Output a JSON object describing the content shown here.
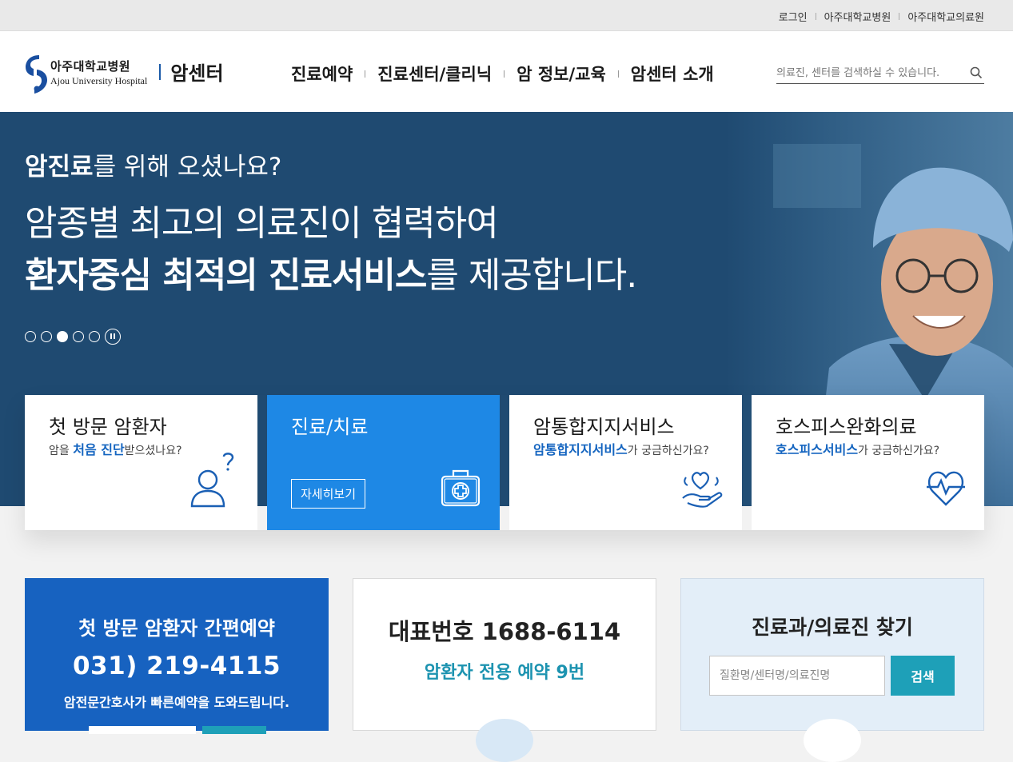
{
  "util_links": [
    "로그인",
    "아주대학교병원",
    "아주대학교의료원"
  ],
  "logo": {
    "kr": "아주대학교병원",
    "en": "Ajou University Hospital",
    "sub": "암센터"
  },
  "nav": [
    "진료예약",
    "진료센터/클리닉",
    "암 정보/교육",
    "암센터 소개"
  ],
  "search": {
    "placeholder": "의료진, 센터를 검색하실 수 있습니다."
  },
  "hero": {
    "q_bold": "암진료",
    "q_rest": "를 위해 오셨나요?",
    "line1": "암종별 최고의 의료진이 협력하여",
    "line2_bold": "환자중심 최적의 진료서비스",
    "line2_rest": "를 제공합니다.",
    "slide_count": 5,
    "active_slide": 3
  },
  "cards": [
    {
      "title": "첫 방문 암환자",
      "sub_pre": "암을 ",
      "sub_em": "처음 진단",
      "sub_post": "받으셨나요?",
      "icon": "person-question-icon"
    },
    {
      "title": "진료/치료",
      "button": "자세히보기",
      "icon": "first-aid-kit-icon"
    },
    {
      "title": "암통합지지서비스",
      "sub_pre": "",
      "sub_em": "암통합지지서비스",
      "sub_post": "가 궁금하신가요?",
      "icon": "heart-hand-icon"
    },
    {
      "title": "호스피스완화의료",
      "sub_pre": "",
      "sub_em": "호스피스서비스",
      "sub_post": "가 궁금하신가요?",
      "icon": "heartbeat-icon"
    }
  ],
  "box1": {
    "title": "첫 방문 암환자 간편예약",
    "phone": "031) 219-4115",
    "note": "암전문간호사가 빠른예약을 도와드립니다."
  },
  "box2": {
    "title": "대표번호 1688-6114",
    "sub": "암환자 전용 예약 9번"
  },
  "box3": {
    "title": "진료과/의료진 찾기",
    "placeholder": "질환명/센터명/의료진명",
    "button": "검색"
  },
  "colors": {
    "hero_bg": "#1f4a71",
    "active_card": "#1e88e5",
    "box1_bg": "#1762c0",
    "accent_teal": "#1ea0b8",
    "link_blue": "#1565c0"
  }
}
